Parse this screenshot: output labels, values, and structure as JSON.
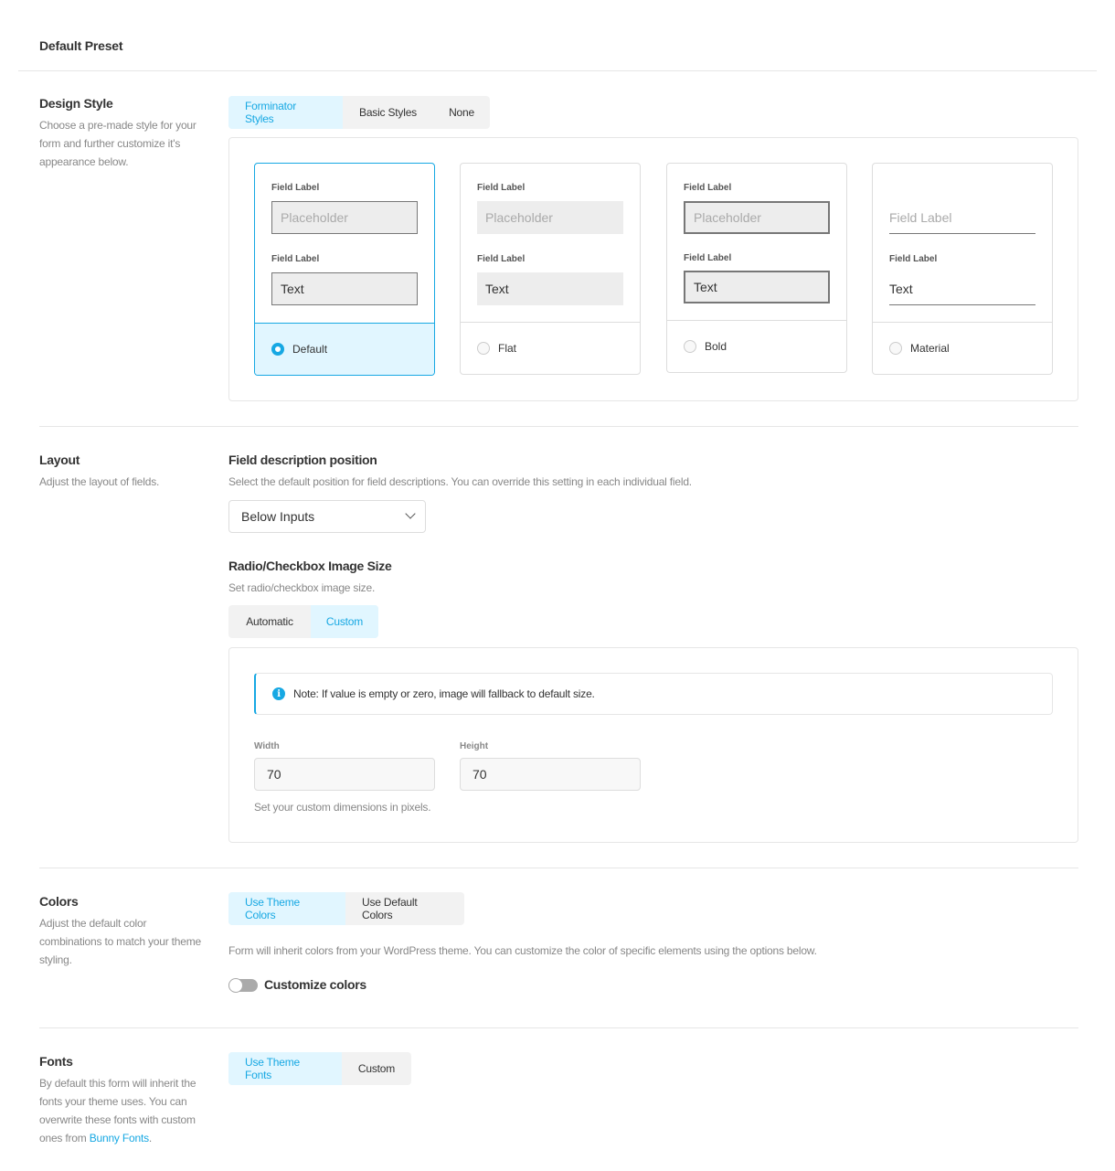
{
  "header": {
    "title": "Default Preset"
  },
  "design_style": {
    "title": "Design Style",
    "description": "Choose a pre-made style for your form and further customize it's appearance below.",
    "tabs": [
      {
        "label": "Forminator Styles",
        "active": true
      },
      {
        "label": "Basic Styles",
        "active": false
      },
      {
        "label": "None",
        "active": false
      }
    ],
    "cards": [
      {
        "name": "Default",
        "label1": "Field Label",
        "placeholder": "Placeholder",
        "label2": "Field Label",
        "value": "Text",
        "selected": true
      },
      {
        "name": "Flat",
        "label1": "Field Label",
        "placeholder": "Placeholder",
        "label2": "Field Label",
        "value": "Text",
        "selected": false
      },
      {
        "name": "Bold",
        "label1": "Field Label",
        "placeholder": "Placeholder",
        "label2": "Field Label",
        "value": "Text",
        "selected": false
      },
      {
        "name": "Material",
        "label1": "Field Label",
        "placeholder": "Field Label",
        "label2": "Field Label",
        "value": "Text",
        "selected": false
      }
    ]
  },
  "layout": {
    "title": "Layout",
    "description": "Adjust the layout of fields.",
    "field_desc_title": "Field description position",
    "field_desc_help": "Select the default position for field descriptions. You can override this setting in each individual field.",
    "field_desc_value": "Below Inputs",
    "image_size_title": "Radio/Checkbox Image Size",
    "image_size_help": "Set radio/checkbox image size.",
    "image_size_tabs": [
      {
        "label": "Automatic",
        "active": false
      },
      {
        "label": "Custom",
        "active": true
      }
    ],
    "notice": "Note: If value is empty or zero, image will fallback to default size.",
    "width_label": "Width",
    "width_value": "70",
    "height_label": "Height",
    "height_value": "70",
    "dimensions_help": "Set your custom dimensions in pixels."
  },
  "colors": {
    "title": "Colors",
    "description": "Adjust the default color combinations to match your theme styling.",
    "tabs": [
      {
        "label": "Use Theme Colors",
        "active": true
      },
      {
        "label": "Use Default Colors",
        "active": false
      }
    ],
    "help": "Form will inherit colors from your WordPress theme. You can customize the color of specific elements using the options below.",
    "toggle_label": "Customize colors",
    "toggle_on": false
  },
  "fonts": {
    "title": "Fonts",
    "description": "By default this form will inherit the fonts your theme uses. You can overwrite these fonts with custom ones from",
    "link_text": "Bunny Fonts",
    "tabs": [
      {
        "label": "Use Theme Fonts",
        "active": true
      },
      {
        "label": "Custom",
        "active": false
      }
    ]
  },
  "colors_theme": {
    "accent": "#17a8e3",
    "accent_bg": "#e1f6ff",
    "border": "#e6e6e6"
  },
  "icons": [
    "chevron-down-icon",
    "info-icon"
  ]
}
